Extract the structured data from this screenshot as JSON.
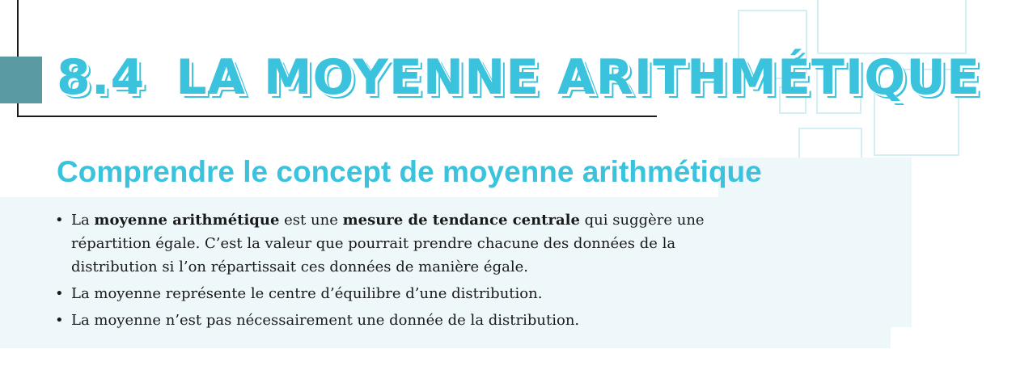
{
  "section": {
    "number": "8.4",
    "title": "LA MOYENNE ARITHMÉTIQUE"
  },
  "subtitle": "Comprendre le concept de moyenne arithmétique",
  "bullets": [
    {
      "t1": "La ",
      "b1": "moyenne arithmétique",
      "t2": " est une ",
      "b2": "mesure de tendance centrale",
      "t3": " qui suggère une répartition égale. C’est la valeur que pourrait prendre chacune des données de la distribution si l’on répartissait ces données de manière égale."
    },
    {
      "text": "La moyenne représente le centre d’équilibre d’une distribution."
    },
    {
      "text": "La moyenne n’est pas nécessairement une donnée de la distribution."
    }
  ],
  "colors": {
    "accent": "#3bc3dd",
    "tab": "#5a9aa3",
    "panel": "#eef8fb",
    "deco": "#d3eef5"
  }
}
